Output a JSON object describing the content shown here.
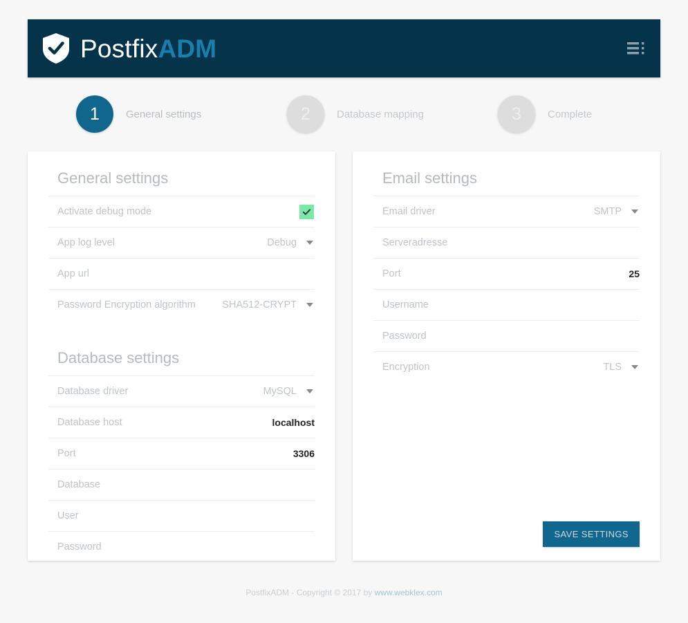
{
  "header": {
    "logo_icon": "shield-check-icon",
    "brand_light": "Postfix",
    "brand_accent": "ADM",
    "menu_icon": "list-menu-icon",
    "background_color": "#04334a",
    "accent_color": "#1a7fad"
  },
  "stepper": {
    "steps": [
      {
        "number": "1",
        "label": "General settings",
        "state": "active"
      },
      {
        "number": "2",
        "label": "Database mapping",
        "state": "inactive"
      },
      {
        "number": "3",
        "label": "Complete",
        "state": "inactive"
      }
    ],
    "active_color": "#11668e",
    "inactive_color": "#dddddd"
  },
  "left_card": {
    "general": {
      "title": "General settings",
      "fields": [
        {
          "label": "Activate debug mode",
          "control": "checkbox",
          "checked": true,
          "value": ""
        },
        {
          "label": "App log level",
          "control": "select",
          "value": "Debug"
        },
        {
          "label": "App url",
          "control": "text",
          "value": ""
        },
        {
          "label": "Password Encryption algorithm",
          "control": "select",
          "value": "SHA512-CRYPT"
        }
      ]
    },
    "database": {
      "title": "Database settings",
      "fields": [
        {
          "label": "Database driver",
          "control": "select",
          "value": "MySQL"
        },
        {
          "label": "Database host",
          "control": "text",
          "value": "localhost"
        },
        {
          "label": "Port",
          "control": "text",
          "value": "3306"
        },
        {
          "label": "Database",
          "control": "text",
          "value": ""
        },
        {
          "label": "User",
          "control": "text",
          "value": ""
        },
        {
          "label": "Password",
          "control": "password",
          "value": ""
        }
      ]
    }
  },
  "right_card": {
    "email": {
      "title": "Email settings",
      "fields": [
        {
          "label": "Email driver",
          "control": "select",
          "value": "SMTP"
        },
        {
          "label": "Serveradresse",
          "control": "text",
          "value": ""
        },
        {
          "label": "Port",
          "control": "text",
          "value": "25"
        },
        {
          "label": "Username",
          "control": "text",
          "value": ""
        },
        {
          "label": "Password",
          "control": "password",
          "value": ""
        },
        {
          "label": "Encryption",
          "control": "select",
          "value": "TLS"
        }
      ]
    },
    "save_label": "SAVE SETTINGS"
  },
  "footer": {
    "text": "PostfixADM - Copyright © 2017 by ",
    "link": "www.webklex.com"
  },
  "checkbox_color": "#7ae8a6"
}
